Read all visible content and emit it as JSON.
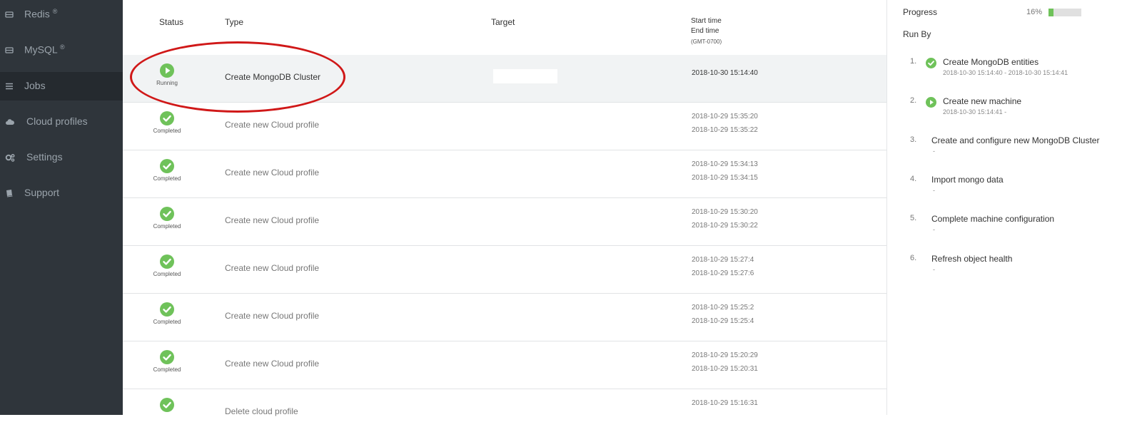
{
  "sidebar": {
    "items": [
      {
        "label": "Redis",
        "mark": "®",
        "icon": "database-icon"
      },
      {
        "label": "MySQL",
        "mark": "®",
        "icon": "database-icon"
      },
      {
        "label": "Jobs",
        "icon": "list-icon",
        "active": true
      },
      {
        "label": "Cloud profiles",
        "icon": "cloud-icon"
      },
      {
        "label": "Settings",
        "icon": "gears-icon"
      },
      {
        "label": "Support",
        "icon": "book-icon"
      }
    ]
  },
  "table": {
    "headers": {
      "status": "Status",
      "type": "Type",
      "target": "Target",
      "start_time": "Start time",
      "end_time": "End time",
      "timezone": "(GMT-0700)"
    },
    "rows": [
      {
        "status": "Running",
        "type": "Create MongoDB Cluster",
        "start": "2018-10-30 15:14:40",
        "end": ""
      },
      {
        "status": "Completed",
        "type": "Create new Cloud profile",
        "start": "2018-10-29 15:35:20",
        "end": "2018-10-29 15:35:22"
      },
      {
        "status": "Completed",
        "type": "Create new Cloud profile",
        "start": "2018-10-29 15:34:13",
        "end": "2018-10-29 15:34:15"
      },
      {
        "status": "Completed",
        "type": "Create new Cloud profile",
        "start": "2018-10-29 15:30:20",
        "end": "2018-10-29 15:30:22"
      },
      {
        "status": "Completed",
        "type": "Create new Cloud profile",
        "start": "2018-10-29 15:27:4",
        "end": "2018-10-29 15:27:6"
      },
      {
        "status": "Completed",
        "type": "Create new Cloud profile",
        "start": "2018-10-29 15:25:2",
        "end": "2018-10-29 15:25:4"
      },
      {
        "status": "Completed",
        "type": "Create new Cloud profile",
        "start": "2018-10-29 15:20:29",
        "end": "2018-10-29 15:20:31"
      },
      {
        "status": "",
        "type": "Delete cloud profile",
        "start": "2018-10-29 15:16:31",
        "end": ""
      }
    ]
  },
  "panel": {
    "progress_label": "Progress",
    "progress_text": "16%",
    "progress_value": 0.16,
    "run_by_label": "Run By",
    "steps": [
      {
        "num": "1.",
        "title": "Create MongoDB entities",
        "sub": "2018-10-30 15:14:40  -  2018-10-30 15:14:41",
        "state": "completed"
      },
      {
        "num": "2.",
        "title": "Create new machine",
        "sub": "2018-10-30 15:14:41  -",
        "state": "running"
      },
      {
        "num": "3.",
        "title": "Create and configure new MongoDB Cluster",
        "sub": "-",
        "state": "pending"
      },
      {
        "num": "4.",
        "title": "Import mongo data",
        "sub": "-",
        "state": "pending"
      },
      {
        "num": "5.",
        "title": "Complete machine configuration",
        "sub": "-",
        "state": "pending"
      },
      {
        "num": "6.",
        "title": "Refresh object health",
        "sub": "-",
        "state": "pending"
      }
    ]
  },
  "colors": {
    "sidebar_bg": "#2f353b",
    "sidebar_active": "#252a2f",
    "success_green": "#6fc25a",
    "annotation_red": "#d01818"
  }
}
